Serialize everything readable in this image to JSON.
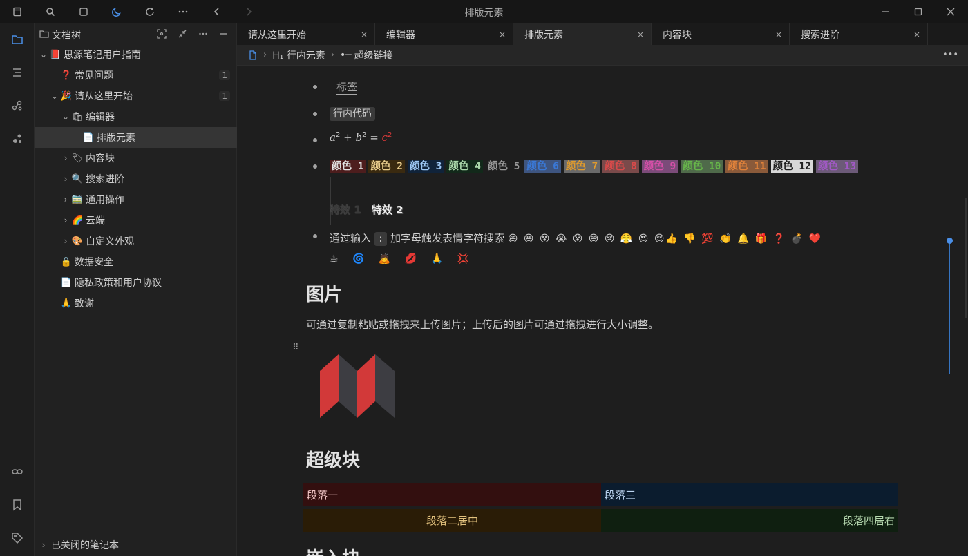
{
  "window": {
    "title": "排版元素"
  },
  "filetree": {
    "title": "文档树",
    "items": [
      {
        "label": "思源笔记用户指南",
        "emoji": "📕",
        "level": 0,
        "expanded": true,
        "count": ""
      },
      {
        "label": "常见问题",
        "emoji": "❓",
        "level": 1,
        "expanded": null,
        "count": "1"
      },
      {
        "label": "请从这里开始",
        "emoji": "🎉",
        "level": 1,
        "expanded": true,
        "count": "1"
      },
      {
        "label": "编辑器",
        "emoji": "🛍",
        "level": 2,
        "expanded": true,
        "count": ""
      },
      {
        "label": "排版元素",
        "emoji": "📄",
        "level": 3,
        "expanded": null,
        "count": ""
      },
      {
        "label": "内容块",
        "emoji": "🏷",
        "level": 2,
        "expanded": false,
        "count": ""
      },
      {
        "label": "搜索进阶",
        "emoji": "🔍",
        "level": 2,
        "expanded": false,
        "count": ""
      },
      {
        "label": "通用操作",
        "emoji": "🚞",
        "level": 2,
        "expanded": false,
        "count": ""
      },
      {
        "label": "云端",
        "emoji": "🌈",
        "level": 2,
        "expanded": false,
        "count": ""
      },
      {
        "label": "自定义外观",
        "emoji": "🎨",
        "level": 2,
        "expanded": false,
        "count": ""
      },
      {
        "label": "数据安全",
        "emoji": "🔒",
        "level": 1,
        "expanded": null,
        "count": ""
      },
      {
        "label": "隐私政策和用户协议",
        "emoji": "📄",
        "level": 1,
        "expanded": null,
        "count": ""
      },
      {
        "label": "致谢",
        "emoji": "🙏",
        "level": 1,
        "expanded": null,
        "count": ""
      }
    ],
    "footer": "已关闭的笔记本"
  },
  "tabs": [
    {
      "label": "请从这里开始",
      "close": "×"
    },
    {
      "label": "编辑器",
      "close": "×"
    },
    {
      "label": "排版元素",
      "close": "×"
    },
    {
      "label": "内容块",
      "close": "×"
    },
    {
      "label": "搜索进阶",
      "close": "×"
    }
  ],
  "breadcrumb": {
    "item1": "H₁ 行内元素",
    "item2": "超级链接",
    "more": "•••"
  },
  "editor": {
    "tag": "标签",
    "inline_code": "行内代码",
    "math": {
      "a": "a",
      "b": "b",
      "c": "c",
      "exp": "2",
      "plus": "+",
      "eq": "="
    },
    "colors": [
      {
        "text": "颜色 1",
        "fg": "#e3e3e3",
        "bg": "#4d1d1d"
      },
      {
        "text": "颜色 2",
        "fg": "#e8cc8c",
        "bg": "#3a2a10"
      },
      {
        "text": "颜色 3",
        "fg": "#9ec8f4",
        "bg": "#10233a"
      },
      {
        "text": "颜色 4",
        "fg": "#a9d6a9",
        "bg": "#12291a"
      },
      {
        "text": "颜色 5",
        "fg": "#9a9a9a",
        "bg": "transparent"
      },
      {
        "text": "颜色 6",
        "fg": "#3a78d6",
        "bg": "#3e5580"
      },
      {
        "text": "颜色 7",
        "fg": "#e09b2d",
        "bg": "#6a6a6a"
      },
      {
        "text": "颜色 8",
        "fg": "#d94a4a",
        "bg": "#7a4a4a"
      },
      {
        "text": "颜色 9",
        "fg": "#d64fa8",
        "bg": "#7b4b79"
      },
      {
        "text": "颜色 10",
        "fg": "#67b64a",
        "bg": "#4f6a4a"
      },
      {
        "text": "颜色 11",
        "fg": "#e0823a",
        "bg": "#8a5a3a"
      },
      {
        "text": "颜色 12",
        "fg": "#1e1e1e",
        "bg": "#d8d8d8"
      },
      {
        "text": "颜色 13",
        "fg": "#a259c6",
        "bg": "#6c5a78"
      }
    ],
    "effects": [
      "特效 1",
      "特效 2"
    ],
    "emoji_line": "通过输入",
    "emoji_key": ":",
    "emoji_desc": "加字母触发表情字符搜索",
    "emojis1": "😄 😆 😵 😭 😰 😅  😢 😤 😍 😌👍 👎 💯 👏 🔔 🎁 ❓ 💣 ❤️",
    "emojis2": "☕ 🌀 🙇 💋 🙏 💢",
    "h_image": "图片",
    "image_desc": "可通过复制粘贴或拖拽来上传图片；上传后的图片可通过拖拽进行大小调整。",
    "h_superblock": "超级块",
    "cells": [
      "段落一",
      "段落三",
      "段落二居中",
      "段落四居右"
    ],
    "h_embed": "嵌入块"
  },
  "colors": {
    "accent": "#4a8fe7",
    "logo_red": "#d23939",
    "logo_dark": "#3d3d42"
  }
}
